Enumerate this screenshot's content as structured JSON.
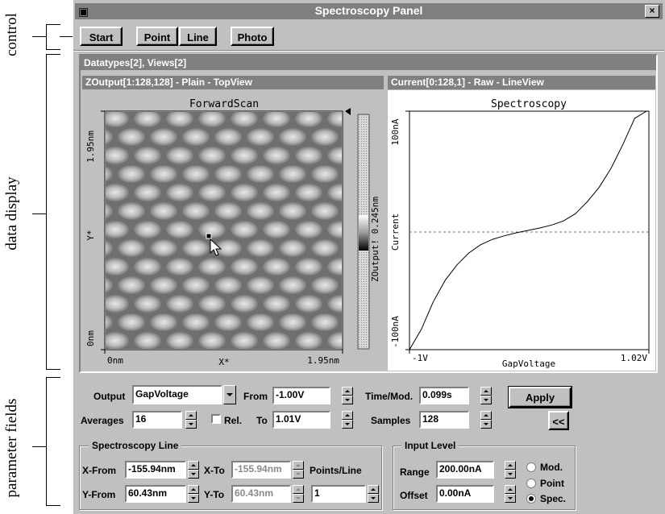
{
  "annotations": {
    "control": "control",
    "data_display": "data display",
    "parameter_fields": "parameter fields"
  },
  "window": {
    "title": "Spectroscopy Panel",
    "close": "×"
  },
  "toolbar": {
    "start": "Start",
    "point": "Point",
    "line": "Line",
    "photo": "Photo"
  },
  "datatypes_header": "Datatypes[2], Views[2]",
  "left_view": {
    "header": "ZOutput[1:128,128] - Plain - TopView",
    "title": "ForwardScan",
    "y_top": "1.95nm",
    "y_mid": "Y*",
    "y_bottom": "0nm",
    "x_left": "0nm",
    "x_mid": "X*",
    "x_right": "1.95nm",
    "colorbar_label": "ZOutput! 0.245nm"
  },
  "right_view": {
    "header": "Current[0:128,1] - Raw - LineView",
    "title": "Spectroscopy",
    "y_top": "100nA",
    "y_mid": "Current",
    "y_bottom": "-100nA",
    "x_left": "-1V",
    "x_mid": "GapVoltage",
    "x_right": "1.02V"
  },
  "chart_data": {
    "type": "line",
    "title": "Spectroscopy",
    "xlabel": "GapVoltage",
    "ylabel": "Current",
    "xlim": [
      -1.0,
      1.02
    ],
    "ylim": [
      -100,
      100
    ],
    "x": [
      -1.0,
      -0.9,
      -0.8,
      -0.7,
      -0.6,
      -0.5,
      -0.4,
      -0.3,
      -0.2,
      -0.1,
      0.0,
      0.1,
      0.2,
      0.3,
      0.4,
      0.5,
      0.6,
      0.7,
      0.8,
      0.9,
      1.0
    ],
    "series": [
      {
        "values": [
          -108,
          -83,
          -60,
          -42,
          -29,
          -19,
          -12,
          -7.5,
          -4.5,
          -2,
          0,
          2,
          4.5,
          8,
          14,
          24,
          36,
          52,
          72,
          94,
          110
        ]
      }
    ]
  },
  "params": {
    "output_label": "Output",
    "output_value": "GapVoltage",
    "from_label": "From",
    "from_value": "-1.00V",
    "to_label": "To",
    "to_value": "1.01V",
    "time_label": "Time/Mod.",
    "time_value": "0.099s",
    "samples_label": "Samples",
    "samples_value": "128",
    "averages_label": "Averages",
    "averages_value": "16",
    "rel_label": "Rel.",
    "apply": "Apply",
    "collapse": "<<"
  },
  "spec_line": {
    "title": "Spectroscopy Line",
    "xfrom_label": "X-From",
    "xfrom_value": "-155.94nm",
    "xto_label": "X-To",
    "xto_value": "-155.94nm",
    "yfrom_label": "Y-From",
    "yfrom_value": "60.43nm",
    "yto_label": "Y-To",
    "yto_value": "60.43nm",
    "points_label": "Points/Line",
    "points_value": "1"
  },
  "input_level": {
    "title": "Input Level",
    "range_label": "Range",
    "range_value": "200.00nA",
    "offset_label": "Offset",
    "offset_value": "0.00nA",
    "mod_label": "Mod.",
    "point_label": "Point",
    "spec_label": "Spec."
  }
}
